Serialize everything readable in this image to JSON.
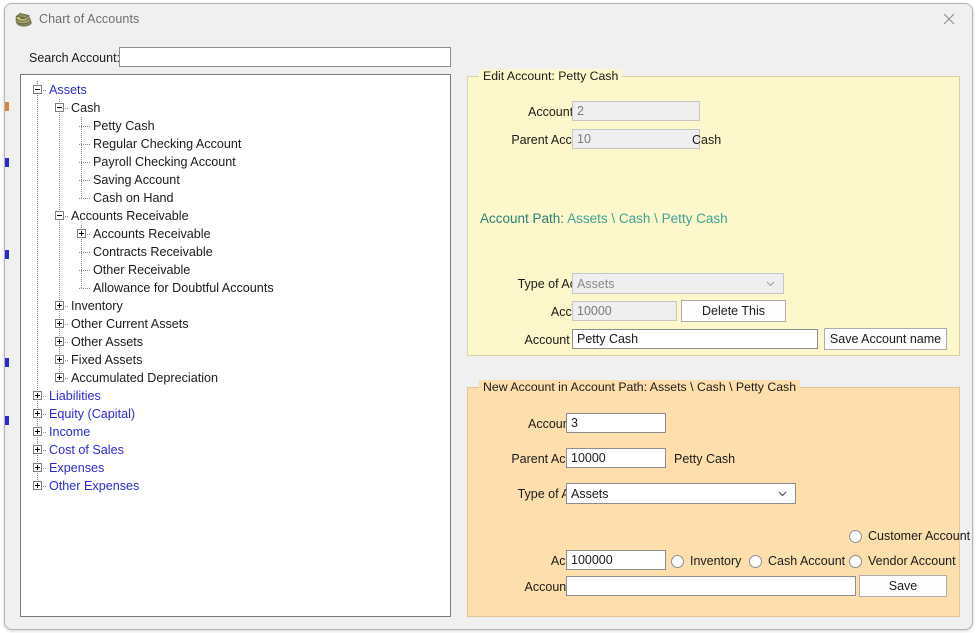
{
  "window": {
    "title": "Chart of Accounts",
    "icon": "money-stack-icon",
    "close_label": "×"
  },
  "search": {
    "label": "Search Account:",
    "value": "",
    "placeholder": ""
  },
  "tree": {
    "nodes": [
      {
        "label": "Assets",
        "level": 0,
        "toggle": "minus",
        "root": true
      },
      {
        "label": "Cash",
        "level": 1,
        "toggle": "minus",
        "root": false
      },
      {
        "label": "Petty Cash",
        "level": 2,
        "toggle": "none",
        "root": false
      },
      {
        "label": "Regular Checking Account",
        "level": 2,
        "toggle": "none",
        "root": false
      },
      {
        "label": "Payroll Checking Account",
        "level": 2,
        "toggle": "none",
        "root": false
      },
      {
        "label": "Saving Account",
        "level": 2,
        "toggle": "none",
        "root": false
      },
      {
        "label": "Cash on Hand",
        "level": 2,
        "toggle": "none",
        "root": false
      },
      {
        "label": "Accounts Receivable",
        "level": 1,
        "toggle": "minus",
        "root": false
      },
      {
        "label": "Accounts Receivable",
        "level": 2,
        "toggle": "plus",
        "root": false
      },
      {
        "label": "Contracts Receivable",
        "level": 2,
        "toggle": "none",
        "root": false
      },
      {
        "label": "Other Receivable",
        "level": 2,
        "toggle": "none",
        "root": false
      },
      {
        "label": "Allowance for Doubtful Accounts",
        "level": 2,
        "toggle": "none",
        "root": false
      },
      {
        "label": "Inventory",
        "level": 1,
        "toggle": "plus",
        "root": false
      },
      {
        "label": "Other Current Assets",
        "level": 1,
        "toggle": "plus",
        "root": false
      },
      {
        "label": "Other Assets",
        "level": 1,
        "toggle": "plus",
        "root": false
      },
      {
        "label": "Fixed Assets",
        "level": 1,
        "toggle": "plus",
        "root": false
      },
      {
        "label": "Accumulated Depreciation",
        "level": 1,
        "toggle": "plus",
        "root": false
      },
      {
        "label": "Liabilities",
        "level": 0,
        "toggle": "plus",
        "root": true
      },
      {
        "label": "Equity (Capital)",
        "level": 0,
        "toggle": "plus",
        "root": true
      },
      {
        "label": "Income",
        "level": 0,
        "toggle": "plus",
        "root": true
      },
      {
        "label": "Cost of Sales",
        "level": 0,
        "toggle": "plus",
        "root": true
      },
      {
        "label": "Expenses",
        "level": 0,
        "toggle": "plus",
        "root": true
      },
      {
        "label": "Other Expenses",
        "level": 0,
        "toggle": "plus",
        "root": true
      }
    ]
  },
  "edit_account": {
    "legend": "Edit Account: Petty Cash",
    "account_level_label": "Account Level:",
    "account_level_value": "2",
    "parent_account_label": "Parent Account #:",
    "parent_account_value": "10",
    "parent_account_name": "Cash",
    "account_path_label": "Account Path:",
    "account_path_value": "Assets \\ Cash \\ Petty Cash",
    "type_of_account_label": "Type of Account:",
    "type_of_account_value": "Assets",
    "account_number_label": "Account #:",
    "account_number_value": "10000",
    "delete_button": "Delete This",
    "account_name_label": "Account Name:",
    "account_name_value": "Petty Cash",
    "save_name_button": "Save Account name"
  },
  "new_account": {
    "legend": "New Account in Account Path:  Assets \\ Cash \\ Petty Cash",
    "account_level_label": "Account Level:",
    "account_level_value": "3",
    "parent_account_label": "Parent Account #:",
    "parent_account_value": "10000",
    "parent_account_name": "Petty Cash",
    "type_of_account_label": "Type of Account:",
    "type_of_account_value": "Assets",
    "account_number_label": "Account #:",
    "account_number_value": "100000",
    "account_name_label": "Account Name:",
    "account_name_value": "",
    "save_button": "Save",
    "radios": {
      "customer": "Customer Account",
      "inventory": "Inventory",
      "cash": "Cash Account",
      "vendor": "Vendor Account"
    }
  },
  "colors": {
    "edit_panel_bg": "#FDF8CC",
    "new_panel_bg": "#FDDFAD",
    "root_node_text": "#2B2BD4",
    "account_path_text": "#2E8B83",
    "window_bg": "#F0F0F0"
  }
}
